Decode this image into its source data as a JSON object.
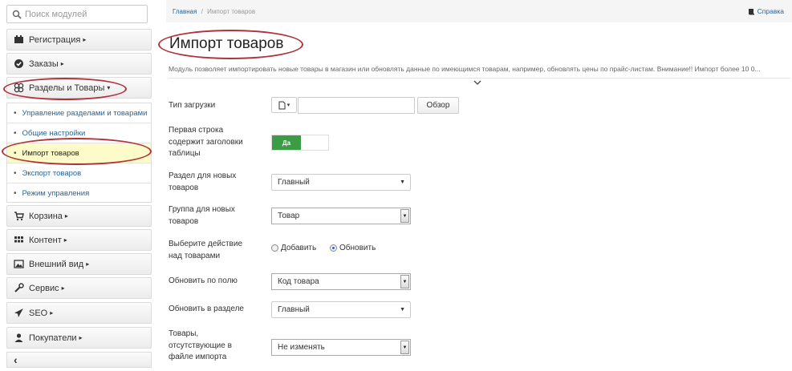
{
  "sidebar": {
    "search_placeholder": "Поиск модулей",
    "sections": [
      {
        "label": "Регистрация",
        "icon": "id-card-icon"
      },
      {
        "label": "Заказы",
        "icon": "check-circle-icon"
      },
      {
        "label": "Разделы и Товары",
        "icon": "cubes-icon"
      },
      {
        "label": "Корзина",
        "icon": "cart-icon"
      },
      {
        "label": "Контент",
        "icon": "grid-icon"
      },
      {
        "label": "Внешний вид",
        "icon": "picture-icon"
      },
      {
        "label": "Сервис",
        "icon": "wrench-icon"
      },
      {
        "label": "SEO",
        "icon": "plane-icon"
      },
      {
        "label": "Покупатели",
        "icon": "user-icon"
      }
    ],
    "subitems": [
      {
        "label": "Управление разделами и товарами"
      },
      {
        "label": "Общие настройки"
      },
      {
        "label": "Импорт товаров",
        "active": true
      },
      {
        "label": "Экспорт товаров"
      },
      {
        "label": "Режим управления"
      }
    ],
    "arrow_right": "▸",
    "arrow_down": "▾",
    "collapse_glyph": "‹"
  },
  "breadcrumb": {
    "home": "Главная",
    "separator": "/",
    "current": "Импорт товаров"
  },
  "help": {
    "label": "Справка"
  },
  "page": {
    "title": "Импорт товаров",
    "description": "Модуль позволяет импортировать новые товары в магазин или обновлять данные по имеющимся товарам, например, обновлять цены по прайс-листам. Внимание!! Импорт более 10 0..."
  },
  "form": {
    "upload_type_label": "Тип загрузки",
    "browse_label": "Обзор",
    "first_row_label": "Первая строка содержит заголовки таблицы",
    "toggle_on_label": "Да",
    "new_section_label": "Раздел для новых товаров",
    "new_section_value": "Главный",
    "new_group_label": "Группа для новых товаров",
    "new_group_value": "Товар",
    "action_label": "Выберите действие над товарами",
    "action_add": "Добавить",
    "action_update": "Обновить",
    "action_selected": "Обновить",
    "update_field_label": "Обновить по полю",
    "update_field_value": "Код товара",
    "update_section_label": "Обновить в разделе",
    "update_section_value": "Главный",
    "missing_label": "Товары, отсутствующие в файле импорта",
    "missing_value": "Не изменять"
  },
  "colors": {
    "highlight": "#b0323a",
    "toggle_on": "#3c9b45",
    "link": "#2a6496",
    "active_bg": "#fdfbc9"
  }
}
